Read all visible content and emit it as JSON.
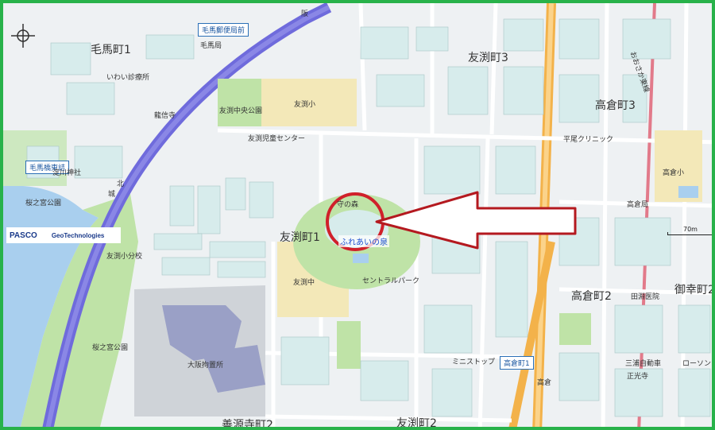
{
  "map": {
    "areas": {
      "kema1": "毛馬町1",
      "tomobuchi3": "友渕町3",
      "takakura3": "高倉町3",
      "tomobuchi1": "友渕町1",
      "takakura2": "高倉町2",
      "miyuki2": "御幸町2",
      "tomobuchi2": "友渕町2",
      "minase2": "善源寺町2"
    },
    "places": {
      "kema_post": "毛馬郵便局前",
      "kema_bashi": "毛馬橋東詰",
      "han": "阪",
      "kema_kyoku": "毛馬局",
      "iwai_clinic": "いわい診療所",
      "ryushinji": "龍信寺",
      "tomobuchi_park": "友渕中央公園",
      "tomobuchi_sho": "友渕小",
      "jidou_center": "友渕児童センター",
      "yodogawa_jinja": "淀川神社",
      "sakuranomiya_park": "桜之宮公園",
      "mamori_no_mori": "守の森",
      "fureai_no_izumi": "ふれあいの泉",
      "bunkou": "友渕小分校",
      "tomobuchi_chu": "友渕中",
      "central_park": "セントラルパーク",
      "sakuranomiya_park2": "桜之宮公園",
      "osaka_prison": "大阪拘置所",
      "takakura_sho": "高倉小",
      "heisei_clinic": "平尾クリニック",
      "takakura_kyoku": "高倉局",
      "takata_clinic": "田淵医院",
      "takakura_station": "高倉町1",
      "mini_stop": "ミニストップ",
      "takakura_label": "高倉",
      "sanura_sho": "三浦自動車",
      "lawson": "ローソン",
      "seiko": "正光寺",
      "osaka_line": "おおさか東線",
      "kitabashi": "北",
      "shiro": "城"
    },
    "attribution": {
      "pasco": "PASCO",
      "geo": "GeoTechnologies"
    },
    "scale": "70m",
    "colors": {
      "water": "#a9cfee",
      "expressway": "#6f6bdc",
      "main_road": "#f3b24a",
      "park": "#bfe3a7",
      "school": "#f3e8b8",
      "building": "#d7ecec",
      "red_circle": "#d0202a",
      "arrow_outline": "#b4191f"
    }
  }
}
